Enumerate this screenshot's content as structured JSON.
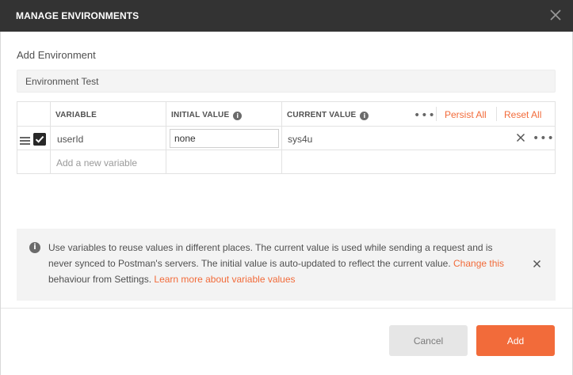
{
  "window": {
    "title": "MANAGE ENVIRONMENTS",
    "close_icon": "close-icon"
  },
  "form": {
    "section_title": "Add Environment",
    "environment_name_value": "Environment Test"
  },
  "table": {
    "columns": {
      "variable": "VARIABLE",
      "initial_value": "INITIAL VALUE",
      "current_value": "CURRENT VALUE"
    },
    "header_actions": {
      "more_icon": "•••",
      "persist_all": "Persist All",
      "reset_all": "Reset All"
    },
    "rows": [
      {
        "enabled": true,
        "variable": "userId",
        "initial_value": "none",
        "current_value": "sys4u",
        "more_icon": "•••"
      }
    ],
    "new_row_placeholder": "Add a new variable"
  },
  "info": {
    "icon_glyph": "i",
    "text": "Use variables to reuse values in different places. The current value is used while sending a request and is never synced to Postman's servers. The initial value is auto-updated to reflect the current value. ",
    "link_change": "Change this",
    "text_after": " behaviour from Settings. ",
    "link_learn": "Learn more about variable values"
  },
  "footer": {
    "cancel_label": "Cancel",
    "add_label": "Add"
  },
  "colors": {
    "accent": "#f26b3a",
    "titlebar": "#333333",
    "checkbox": "#282828"
  }
}
